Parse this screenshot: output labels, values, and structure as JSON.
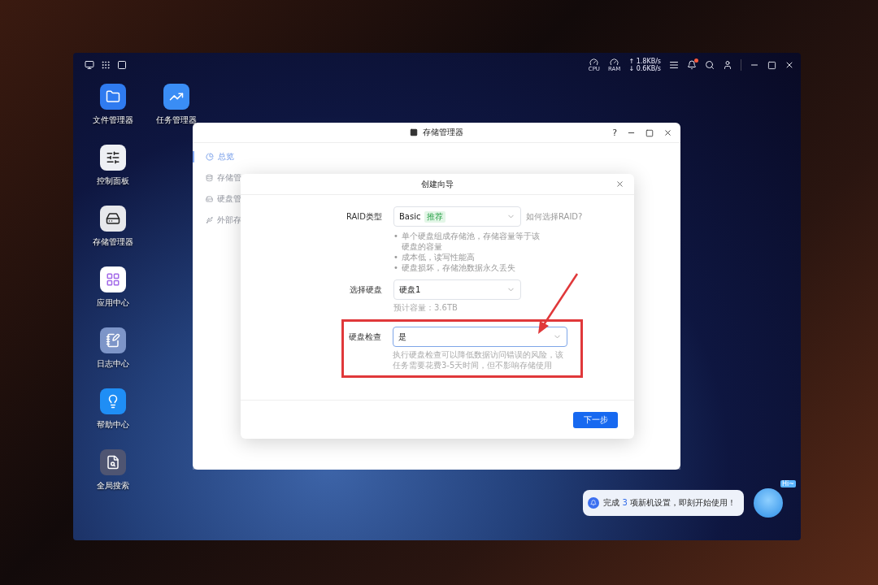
{
  "top_bar": {
    "cpu_label": "CPU",
    "ram_label": "RAM",
    "upload": "↑ 1.8KB/s",
    "download": "↓ 0.6KB/s",
    "has_notification": true
  },
  "desktop_icons": [
    {
      "label": "文件管理器",
      "kind": "files"
    },
    {
      "label": "任务管理器",
      "kind": "tasks"
    },
    {
      "label": "控制面板",
      "kind": "control"
    },
    {
      "label": "存储管理器",
      "kind": "storage"
    },
    {
      "label": "应用中心",
      "kind": "apps"
    },
    {
      "label": "日志中心",
      "kind": "logs"
    },
    {
      "label": "帮助中心",
      "kind": "help"
    },
    {
      "label": "全局搜索",
      "kind": "search"
    }
  ],
  "window": {
    "title": "存储管理器",
    "help": "?",
    "sidebar": [
      {
        "label": "总览",
        "selected": true
      },
      {
        "label": "存储管",
        "selected": false
      },
      {
        "label": "硬盘管",
        "selected": false
      },
      {
        "label": "外部存",
        "selected": false
      }
    ]
  },
  "dialog": {
    "title": "创建向导",
    "fields": [
      {
        "label": "RAID类型",
        "value": "Basic",
        "tag": "推荐",
        "link": "如何选择RAID?",
        "focused": false,
        "highlighted": false,
        "marker": "•",
        "bullets": [
          "单个硬盘组成存储池，存储容量等于该硬盘的容量",
          "成本低，读写性能高",
          "硬盘损坏，存储池数据永久丢失"
        ]
      },
      {
        "label": "选择硬盘",
        "value": "硬盘1",
        "focused": false,
        "highlighted": false,
        "hint": "预计容量：3.6TB"
      },
      {
        "label": "硬盘检查",
        "value": "是",
        "focused": true,
        "highlighted": true,
        "hint": "执行硬盘检查可以降低数据访问错误的风险，该任务需要花费3-5天时间，但不影响存储使用"
      }
    ],
    "next_button": "下一步"
  },
  "assistant": {
    "prefix": "完成",
    "count": "3",
    "suffix": "项新机设置，即刻开始使用！",
    "greeting": "Hi~"
  }
}
